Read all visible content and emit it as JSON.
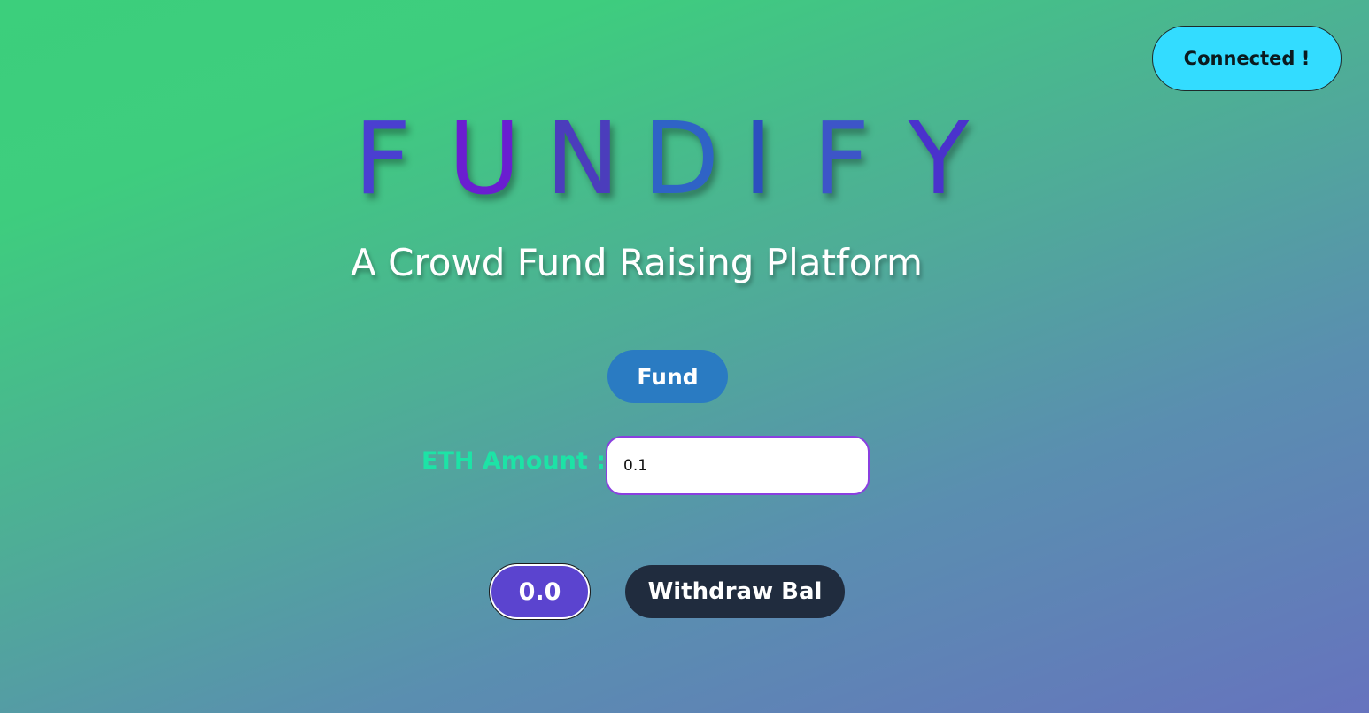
{
  "header": {
    "connect_label": "Connected !"
  },
  "brand": {
    "letters": [
      "F",
      "U",
      "N",
      "D",
      "I",
      "F",
      "Y"
    ]
  },
  "tagline": "A Crowd Fund Raising Platform",
  "fund": {
    "button_label": "Fund",
    "amount_label": "ETH Amount :",
    "amount_value": "0.1"
  },
  "balance": {
    "value": "0.0",
    "withdraw_label": "Withdraw Bal"
  },
  "colors": {
    "connect_button": "#33dcff",
    "fund_button": "#2a7bc2",
    "balance_button": "#5b44cf",
    "withdraw_button": "#202c3e",
    "eth_label": "#1de3a6"
  }
}
